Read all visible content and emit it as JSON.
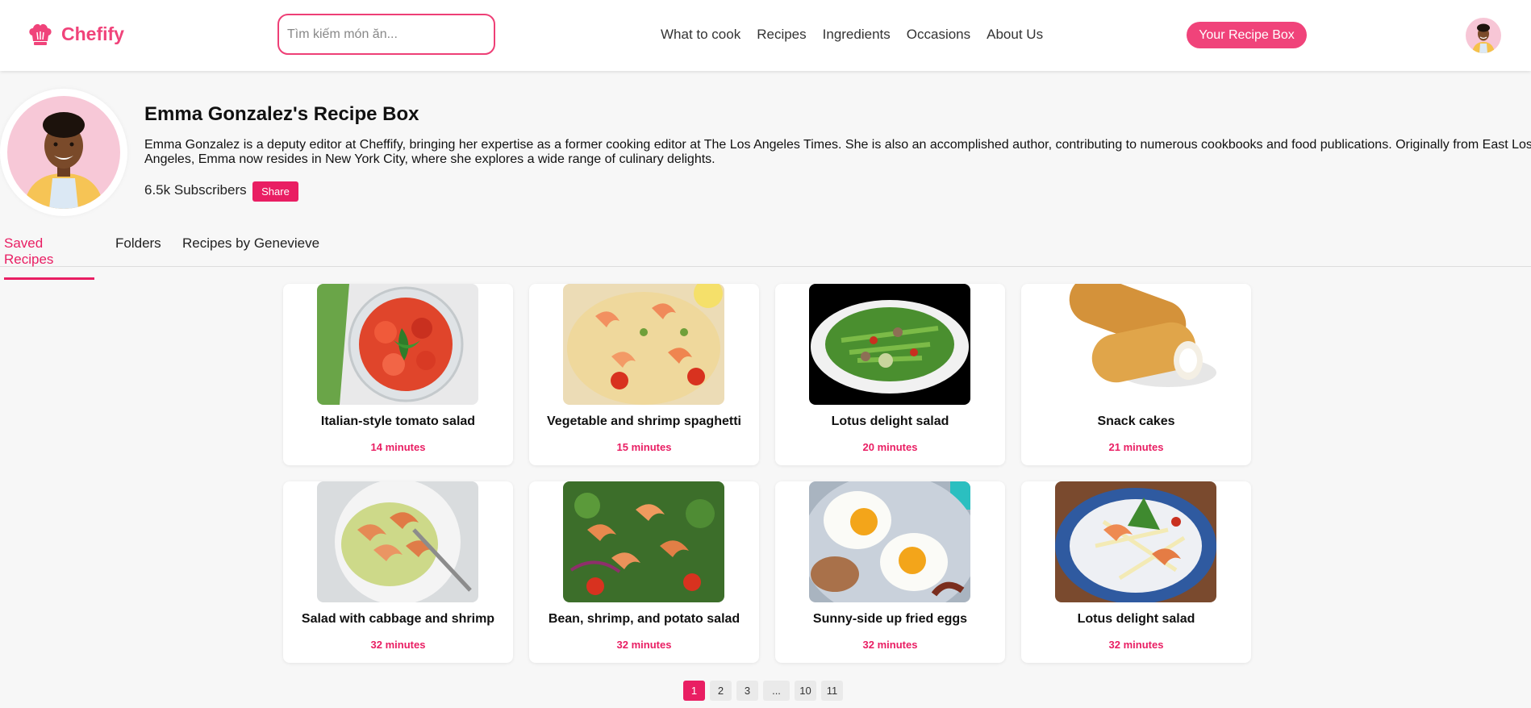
{
  "header": {
    "brand": "Chefify",
    "search_placeholder": "Tìm kiếm món ăn...",
    "nav": [
      "What to cook",
      "Recipes",
      "Ingredients",
      "Occasions",
      "About Us"
    ],
    "cta_label": "Your Recipe Box"
  },
  "profile": {
    "name": "Emma Gonzalez's Recipe Box",
    "bio": "Emma Gonzalez is a deputy editor at Cheffify, bringing her expertise as a former cooking editor at The Los Angeles Times. She is also an accomplished author, contributing to numerous cookbooks and food publications. Originally from East Los Angeles, Emma now resides in New York City, where she explores a wide range of culinary delights.",
    "subscribers": "6.5k Subscribers",
    "share_label": "Share"
  },
  "tabs": [
    "Saved Recipes",
    "Folders",
    "Recipes by Genevieve"
  ],
  "recipes": [
    {
      "title": "Italian-style tomato salad",
      "time": "14 minutes"
    },
    {
      "title": "Vegetable and shrimp spaghetti",
      "time": "15 minutes"
    },
    {
      "title": "Lotus delight salad",
      "time": "20 minutes"
    },
    {
      "title": "Snack cakes",
      "time": "21 minutes"
    },
    {
      "title": "Salad with cabbage and shrimp",
      "time": "32 minutes"
    },
    {
      "title": "Bean, shrimp, and potato salad",
      "time": "32 minutes"
    },
    {
      "title": "Sunny-side up fried eggs",
      "time": "32 minutes"
    },
    {
      "title": "Lotus delight salad",
      "time": "32 minutes"
    }
  ],
  "pagination": [
    "1",
    "2",
    "3",
    "...",
    "10",
    "11"
  ],
  "colors": {
    "accent": "#e91e63",
    "brand": "#f0437a"
  }
}
